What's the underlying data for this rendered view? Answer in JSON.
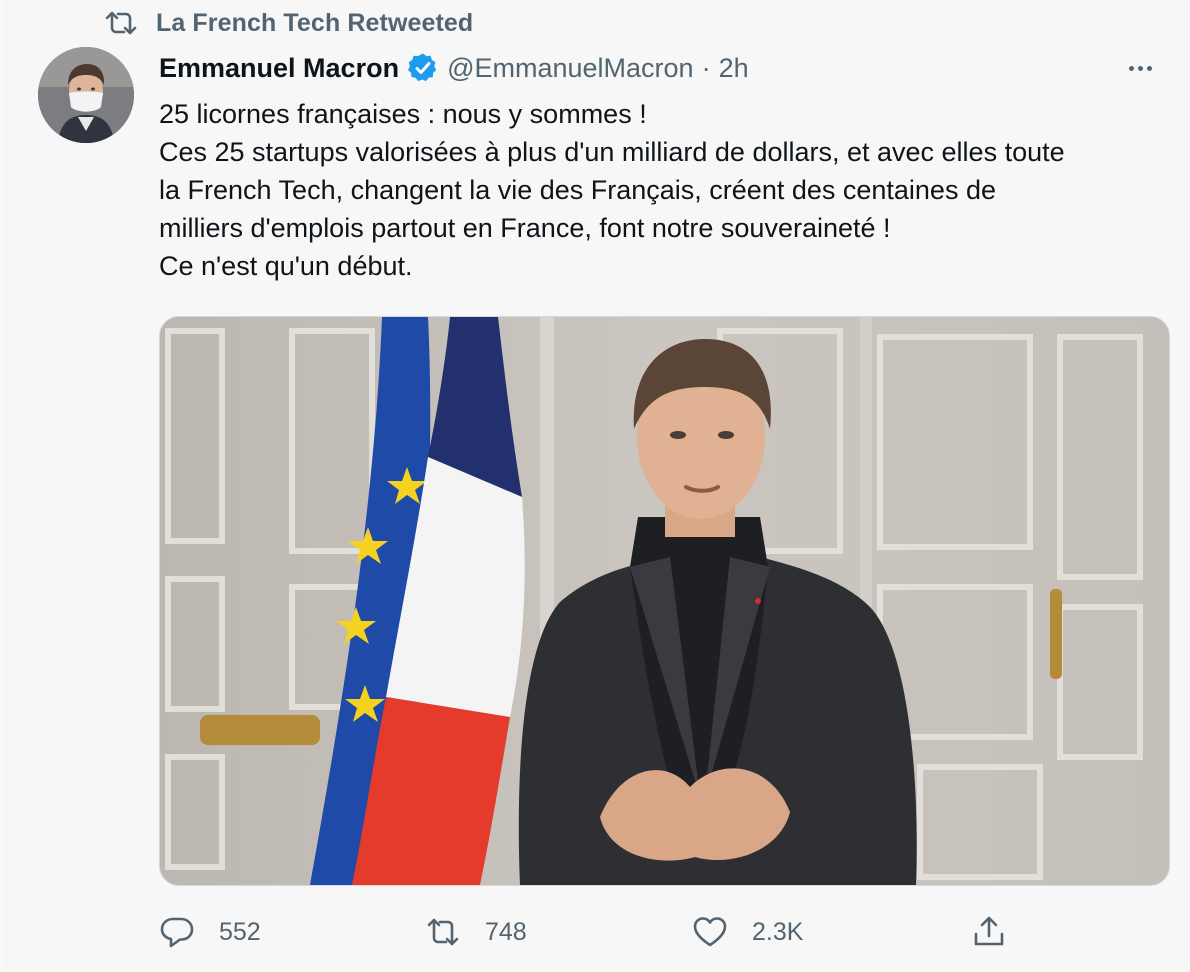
{
  "retweet_context": {
    "icon": "retweet-icon",
    "text": "La French Tech Retweeted"
  },
  "tweet": {
    "author": {
      "display_name": "Emmanuel Macron",
      "verified_icon": "verified-badge-icon",
      "handle": "@EmmanuelMacron",
      "separator": "·",
      "time": "2h"
    },
    "more_icon": "more-horizontal-icon",
    "text_lines": [
      "25 licornes françaises : nous y sommes !",
      "Ces 25 startups valorisées à plus d'un milliard de dollars, et avec elles toute",
      "la French Tech, changent la vie des Français, créent des centaines de",
      "milliers d'emplois partout en France, font notre souveraineté !",
      "Ce n'est qu'un début."
    ],
    "actions": {
      "reply": {
        "icon": "reply-icon",
        "count": "552"
      },
      "retweet": {
        "icon": "retweet-icon",
        "count": "748"
      },
      "like": {
        "icon": "heart-icon",
        "count": "2.3K"
      },
      "share": {
        "icon": "share-icon"
      }
    }
  },
  "colors": {
    "secondary_text": "#536471",
    "verified_blue": "#1d9bf0",
    "eu_blue": "#1f4aa8",
    "eu_star": "#f5d21f",
    "fr_blue": "#23306e",
    "fr_white": "#f4f4f4",
    "fr_red": "#e53b2d"
  }
}
